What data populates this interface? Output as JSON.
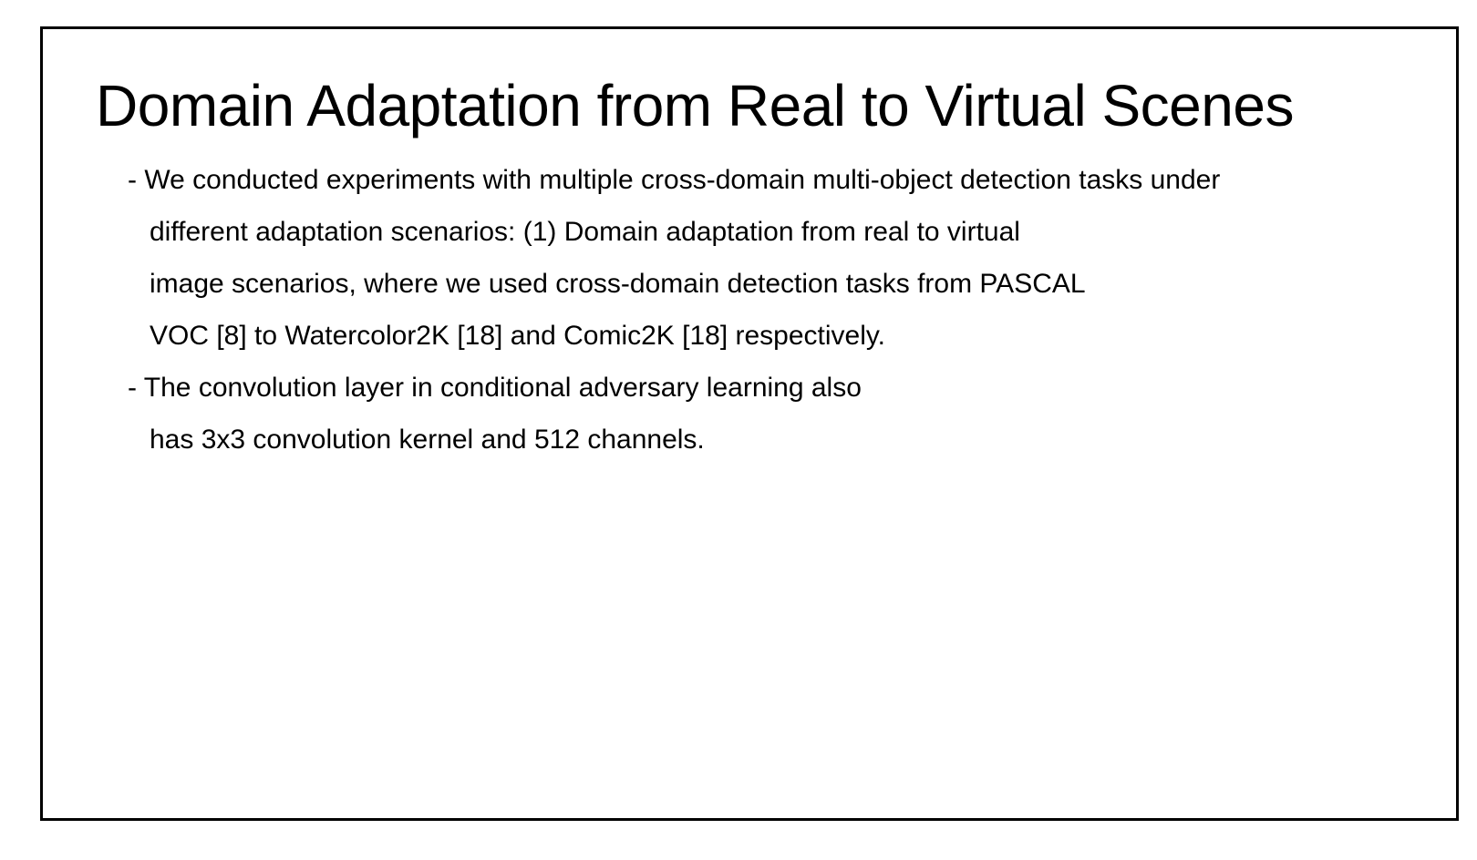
{
  "slide": {
    "title": "Domain Adaptation from Real to Virtual Scenes",
    "bullets": [
      {
        "lines": [
          "- We conducted experiments with multiple cross-domain multi-object detection tasks under",
          "different adaptation scenarios: (1) Domain adaptation from real to virtual",
          "image scenarios, where we used cross-domain detection tasks from PASCAL",
          "VOC [8] to Watercolor2K [18] and Comic2K [18] respectively."
        ]
      },
      {
        "lines": [
          "- The convolution layer in conditional adversary learning also",
          "has 3x3 convolution kernel and 512 channels."
        ]
      }
    ]
  }
}
